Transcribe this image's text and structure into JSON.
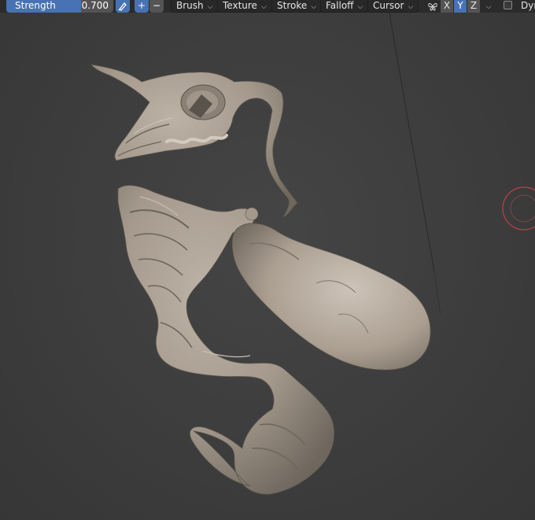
{
  "toolbar": {
    "strength": {
      "label": "Strength",
      "value": "0.700",
      "fraction": 0.7
    },
    "add_glyph": "+",
    "subtract_glyph": "−",
    "menus": [
      "Brush",
      "Texture",
      "Stroke",
      "Falloff",
      "Cursor"
    ],
    "chevron": "⌄",
    "axes": [
      {
        "label": "X",
        "active": false
      },
      {
        "label": "Y",
        "active": true
      },
      {
        "label": "Z",
        "active": false
      }
    ],
    "dyntopo_label": "Dyn"
  },
  "icons": {
    "pressure": "pen-pressure-icon",
    "symmetry": "butterfly-mirror-icon",
    "brush_cursor": "brush-cursor-circle-icon"
  },
  "colors": {
    "accent": "#4772b3",
    "sculpt_clay": "#a89d90",
    "viewport_bg": "#3d3d3d",
    "cursor_ring": "#c0403f"
  }
}
